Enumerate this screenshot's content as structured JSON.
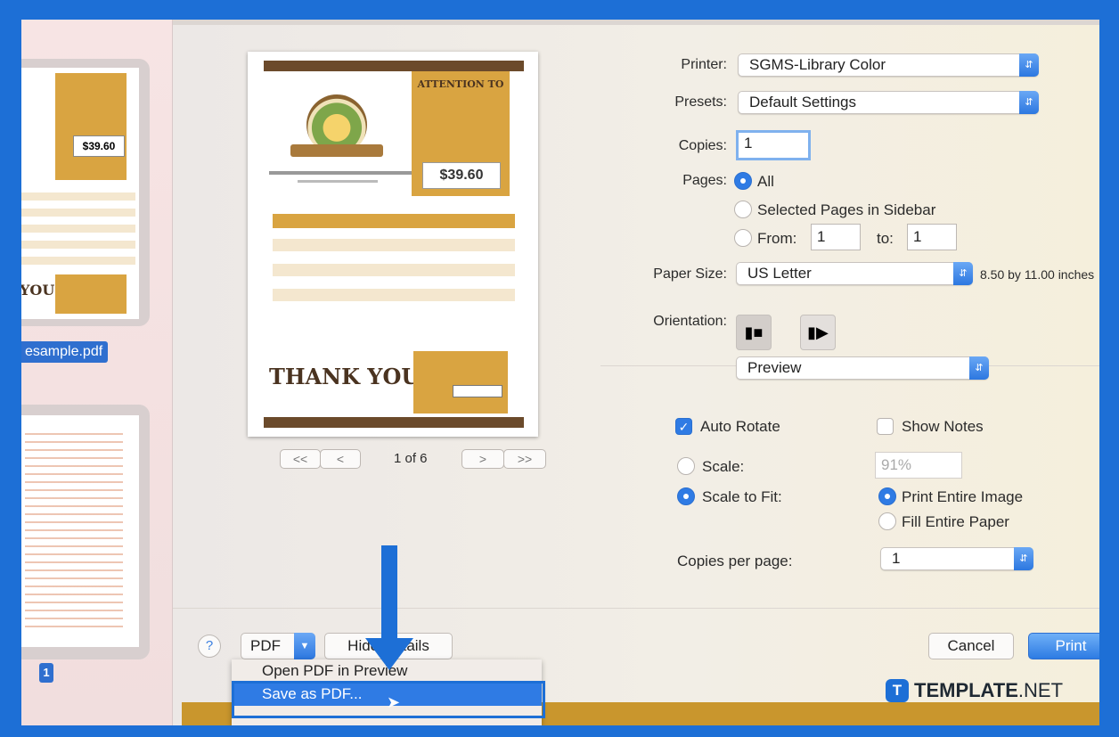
{
  "sidebar": {
    "filename": "esample.pdf",
    "page_number": "1"
  },
  "preview": {
    "attention_heading": "ATTENTION TO",
    "amount": "$39.60",
    "thank_you": "THANK YOU",
    "page_indicator": "1 of 6",
    "nav_first": "<<",
    "nav_prev": "<",
    "nav_next": ">",
    "nav_last": ">>"
  },
  "form": {
    "printer_label": "Printer:",
    "printer_value": "SGMS-Library Color",
    "presets_label": "Presets:",
    "presets_value": "Default Settings",
    "copies_label": "Copies:",
    "copies_value": "1",
    "pages_label": "Pages:",
    "pages_all": "All",
    "pages_selected": "Selected Pages in Sidebar",
    "pages_from": "From:",
    "pages_from_value": "1",
    "pages_to": "to:",
    "pages_to_value": "1",
    "paper_size_label": "Paper Size:",
    "paper_size_value": "US Letter",
    "paper_size_dims": "8.50 by 11.00 inches",
    "orientation_label": "Orientation:",
    "section_value": "Preview",
    "auto_rotate": "Auto Rotate",
    "show_notes": "Show Notes",
    "scale_label": "Scale:",
    "scale_value": "91%",
    "scale_to_fit": "Scale to Fit:",
    "print_entire_image": "Print Entire Image",
    "fill_entire_paper": "Fill Entire Paper",
    "copies_per_page_label": "Copies per page:",
    "copies_per_page_value": "1"
  },
  "footer": {
    "help": "?",
    "pdf_button": "PDF",
    "hide_details": "Hide Details",
    "cancel": "Cancel",
    "print": "Print"
  },
  "pdf_menu": {
    "items": [
      "Open PDF in Preview",
      "Save as PDF..."
    ]
  },
  "watermark": {
    "brand_bold": "TEMPLATE",
    "brand_light": ".NET",
    "logo_letter": "T"
  },
  "colors": {
    "accent": "#2f7be4",
    "frame": "#1d6fd6",
    "invoice_brown": "#6b4a2b",
    "invoice_gold": "#d9a441"
  }
}
